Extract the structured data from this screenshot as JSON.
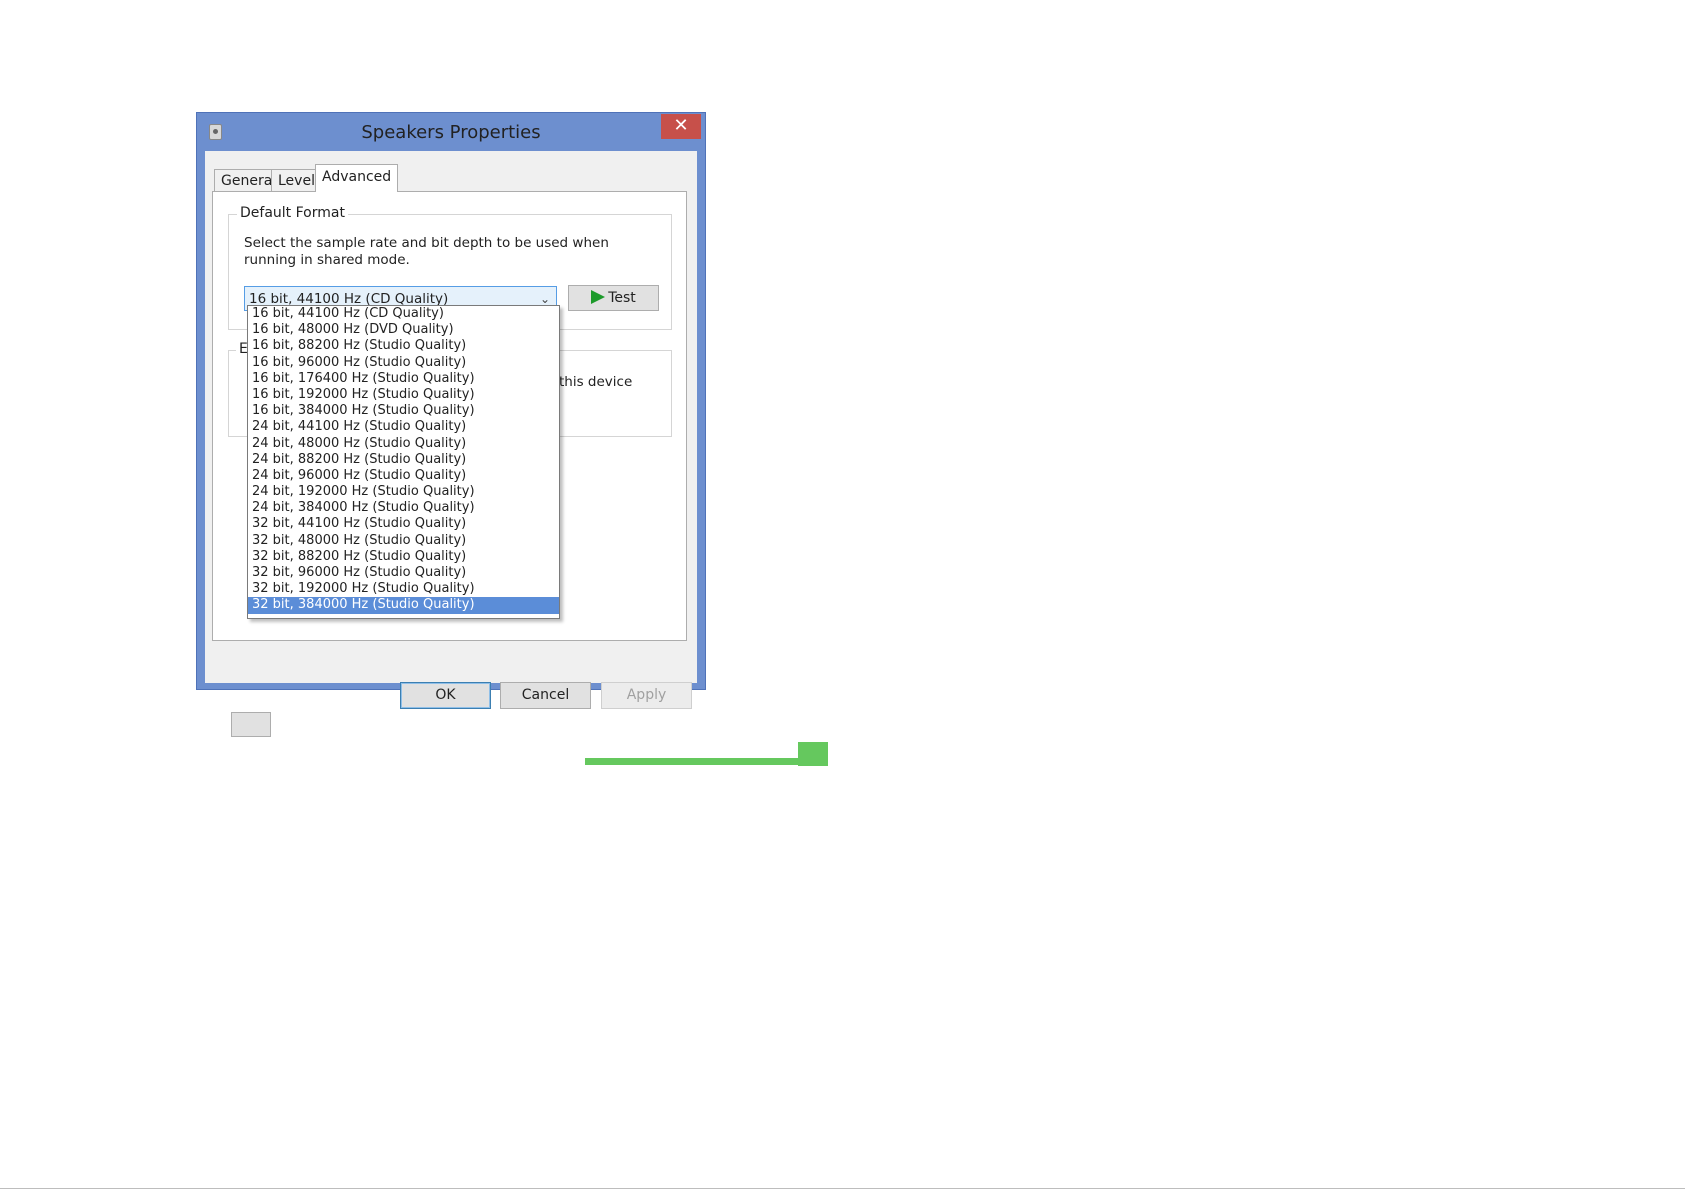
{
  "window": {
    "title": "Speakers Properties",
    "close_glyph": "✕"
  },
  "tabs": [
    {
      "label": "General"
    },
    {
      "label": "Levels"
    },
    {
      "label": "Advanced"
    }
  ],
  "default_format": {
    "group_label": "Default Format",
    "description": "Select the sample rate and bit depth to be used when running in shared mode.",
    "selected_value": "16 bit, 44100 Hz (CD Quality)",
    "test_button": "Test",
    "options": [
      "16 bit, 44100 Hz (CD Quality)",
      "16 bit, 48000 Hz (DVD Quality)",
      "16 bit, 88200 Hz (Studio Quality)",
      "16 bit, 96000 Hz (Studio Quality)",
      "16 bit, 176400 Hz (Studio Quality)",
      "16 bit, 192000 Hz (Studio Quality)",
      "16 bit, 384000 Hz (Studio Quality)",
      "24 bit, 44100 Hz (Studio Quality)",
      "24 bit, 48000 Hz (Studio Quality)",
      "24 bit, 88200 Hz (Studio Quality)",
      "24 bit, 96000 Hz (Studio Quality)",
      "24 bit, 192000 Hz (Studio Quality)",
      "24 bit, 384000 Hz (Studio Quality)",
      "32 bit, 44100 Hz (Studio Quality)",
      "32 bit, 48000 Hz (Studio Quality)",
      "32 bit, 88200 Hz (Studio Quality)",
      "32 bit, 96000 Hz (Studio Quality)",
      "32 bit, 192000 Hz (Studio Quality)",
      "32 bit, 384000 Hz (Studio Quality)"
    ],
    "highlighted_option": "32 bit, 384000 Hz (Studio Quality)"
  },
  "exclusive_mode": {
    "group_label_partial": "E",
    "text_partial": "this device"
  },
  "buttons": {
    "ok": "OK",
    "cancel": "Cancel",
    "apply": "Apply"
  },
  "progress": {
    "percent": 100,
    "color": "#65c85e"
  },
  "colors": {
    "title_bar": "#6d8fcf",
    "close_button": "#c7504a",
    "selection": "#5b8dd8"
  }
}
